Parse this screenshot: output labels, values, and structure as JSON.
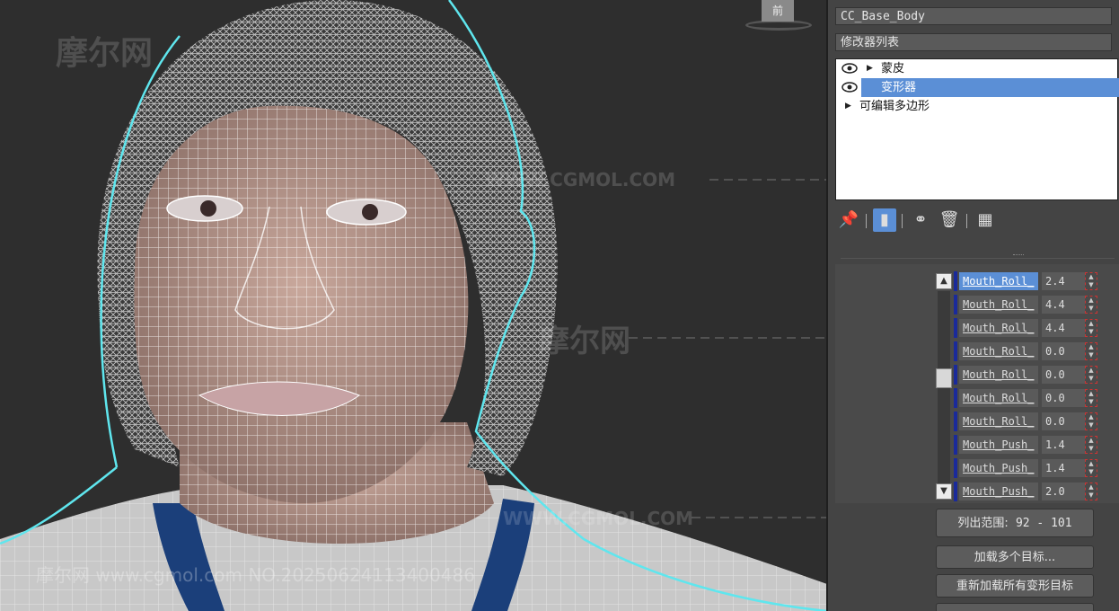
{
  "panel": {
    "object_name": "CC_Base_Body",
    "modifier_list_label": "修改器列表",
    "stack": [
      {
        "label": "蒙皮",
        "selected": false
      },
      {
        "label": "变形器",
        "selected": true
      },
      {
        "label": "可编辑多边形",
        "selected": false
      }
    ],
    "toolbar_icons": [
      "pin-stack-icon",
      "show-end-result-icon",
      "make-unique-icon",
      "remove-modifier-icon",
      "configure-modifier-sets-icon"
    ],
    "channels": [
      {
        "name": "Mouth_Roll_",
        "value": "2.4"
      },
      {
        "name": "Mouth_Roll_",
        "value": "4.4"
      },
      {
        "name": "Mouth_Roll_",
        "value": "4.4"
      },
      {
        "name": "Mouth_Roll_",
        "value": "0.0"
      },
      {
        "name": "Mouth_Roll_",
        "value": "0.0"
      },
      {
        "name": "Mouth_Roll_",
        "value": "0.0"
      },
      {
        "name": "Mouth_Roll_",
        "value": "0.0"
      },
      {
        "name": "Mouth_Push_",
        "value": "1.4"
      },
      {
        "name": "Mouth_Push_",
        "value": "1.4"
      },
      {
        "name": "Mouth_Push_",
        "value": "2.0"
      }
    ],
    "list_range_label": "列出范围:",
    "list_range_value": "92 - 101",
    "load_targets_button": "加载多个目标...",
    "reload_targets_button": "重新加载所有变形目标"
  },
  "viewport": {
    "viewcube_label": "前",
    "colors": {
      "background": "#2e2e2e",
      "wireframe": "#ffffff",
      "spline": "#5fe6ee",
      "skin": "#b4948a",
      "shirt_trim": "#1b3f7a"
    }
  },
  "watermarks": {
    "logo": "摩尔网",
    "domain": "WWW.CGMOL.COM",
    "footer": "摩尔网 www.cgmol.com NO.20250624113400486"
  }
}
